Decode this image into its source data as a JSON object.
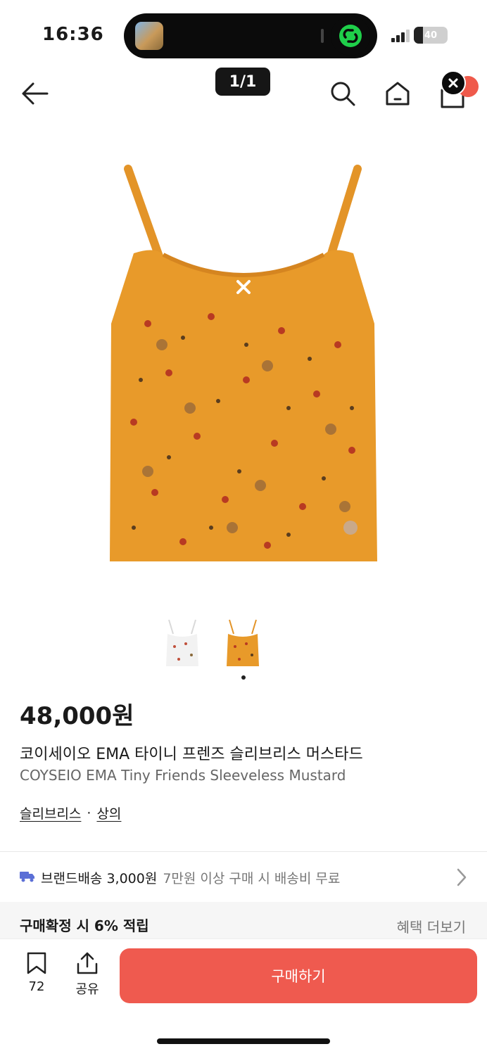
{
  "status_bar": {
    "time": "16:36",
    "battery": "40"
  },
  "nav": {
    "page_indicator": "1/1"
  },
  "product": {
    "price": "48,000원",
    "name_ko": "코이세이오 EMA 타이니 프렌즈 슬리브리스 머스타드",
    "name_en": "COYSEIO EMA Tiny Friends Sleeveless Mustard",
    "categories": [
      "슬리브리스",
      "상의"
    ],
    "category_separator": "·"
  },
  "shipping": {
    "label": "브랜드배송 3,000원",
    "note": "7만원 이상 구매 시 배송비 무료"
  },
  "rewards": {
    "text": "구매확정 시 6% 적립",
    "more_label": "혜택 더보기"
  },
  "bottom": {
    "save_count": "72",
    "share_label": "공유",
    "buy_label": "구매하기"
  },
  "colors": {
    "accent": "#ef5a4f",
    "product_mustard": "#e89a2a",
    "truck": "#5b6fd6"
  },
  "icons": [
    "back-arrow-icon",
    "search-icon",
    "home-icon",
    "cart-icon",
    "close-icon",
    "truck-icon",
    "chevron-right-icon",
    "bookmark-icon",
    "share-icon"
  ]
}
